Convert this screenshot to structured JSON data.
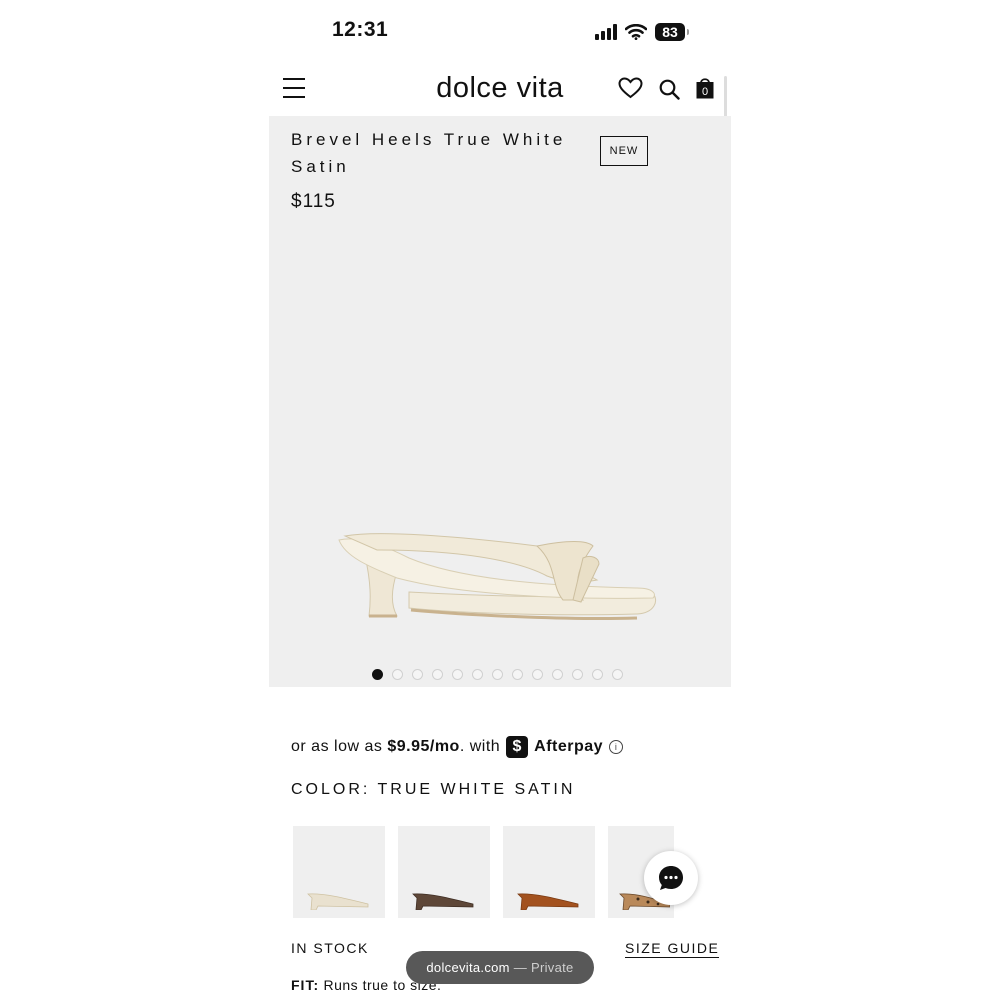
{
  "status_bar": {
    "time": "12:31",
    "battery": "83"
  },
  "header": {
    "brand": "dolce vita",
    "cart_count": "0"
  },
  "product": {
    "title": "Brevel Heels True White Satin",
    "price": "$115",
    "badge": "NEW",
    "image_count": 13,
    "active_image": 1
  },
  "afterpay": {
    "prefix": "or as low as",
    "amount": "$9.95/mo",
    "suffix": ". with",
    "brand": "Afterpay"
  },
  "color": {
    "label": "COLOR: TRUE WHITE SATIN"
  },
  "swatches": [
    {
      "name": "true-white-satin",
      "color": "#e9e1cf"
    },
    {
      "name": "dark-brown",
      "color": "#5e4738"
    },
    {
      "name": "cognac",
      "color": "#a3521f"
    },
    {
      "name": "leopard",
      "color": "#b9895a"
    }
  ],
  "availability": {
    "stock": "IN STOCK",
    "size_guide": "SIZE GUIDE"
  },
  "fit": {
    "label": "FIT:",
    "text": "Runs true to size."
  },
  "browser": {
    "url": "dolcevita.com",
    "mode": "— Private"
  },
  "colors": {
    "accent": "#111111",
    "hero_bg": "#efefef",
    "pill_bg": "#585858"
  }
}
